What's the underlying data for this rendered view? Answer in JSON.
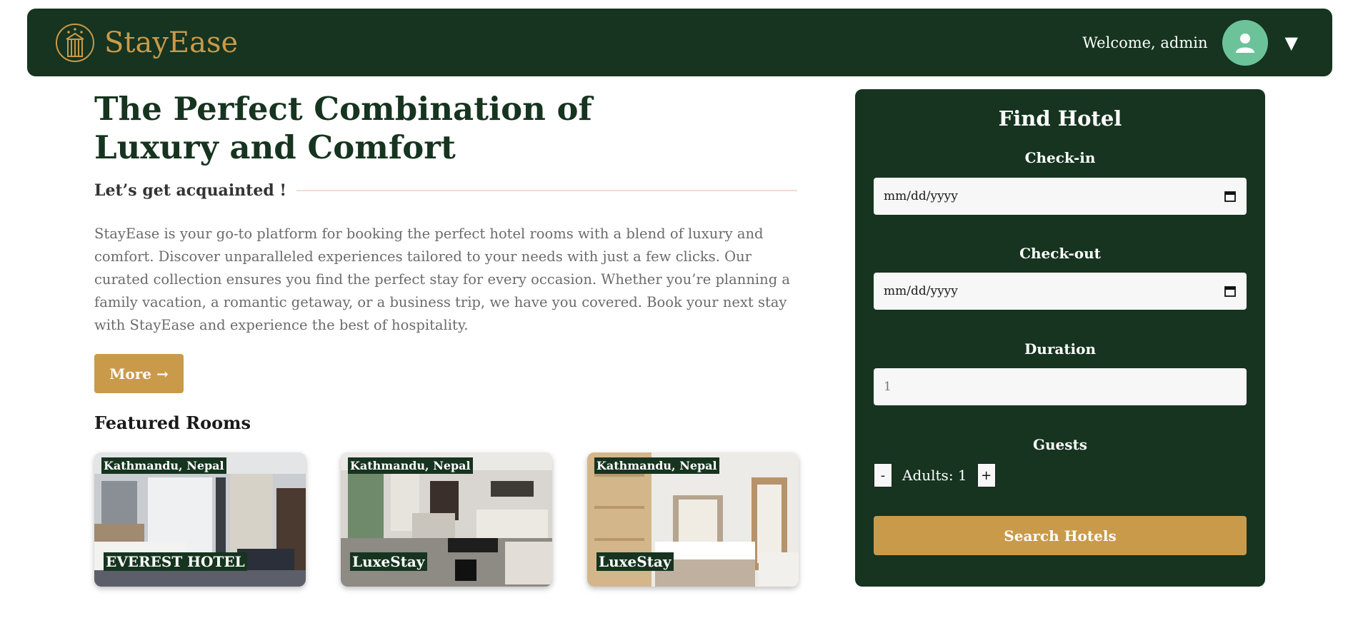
{
  "header": {
    "brand": "StayEase",
    "welcome": "Welcome, admin",
    "dropdown_caret": "▼",
    "logo_icon": "hotel-logo-icon",
    "avatar_icon": "user-avatar-icon"
  },
  "hero": {
    "title": "The Perfect Combination of Luxury and Comfort",
    "subtitle": "Let’s get acquainted !",
    "description": "StayEase is your go-to platform for booking the perfect hotel rooms with a blend of luxury and comfort. Discover unparalleled experiences tailored to your needs with just a few clicks. Our curated collection ensures you find the perfect stay for every occasion. Whether you’re planning a family vacation, a romantic getaway, or a business trip, we have you covered. Book your next stay with StayEase and experience the best of hospitality.",
    "more_label": "More →"
  },
  "featured": {
    "title": "Featured Rooms",
    "rooms": [
      {
        "location": "Kathmandu, Nepal",
        "name": "EVEREST HOTEL"
      },
      {
        "location": "Kathmandu, Nepal",
        "name": "LuxeStay"
      },
      {
        "location": "Kathmandu, Nepal",
        "name": "LuxeStay"
      }
    ]
  },
  "search": {
    "title": "Find Hotel",
    "checkin_label": "Check-in",
    "checkin_placeholder": "mm/dd/yyyy",
    "checkout_label": "Check-out",
    "checkout_placeholder": "mm/dd/yyyy",
    "duration_label": "Duration",
    "duration_value": "1",
    "guests_label": "Guests",
    "minus": "-",
    "adults_text": "Adults: 1",
    "plus": "+",
    "search_button": "Search Hotels"
  },
  "colors": {
    "primary": "#16341f",
    "accent": "#c99a4a",
    "avatar": "#6cc39a"
  }
}
